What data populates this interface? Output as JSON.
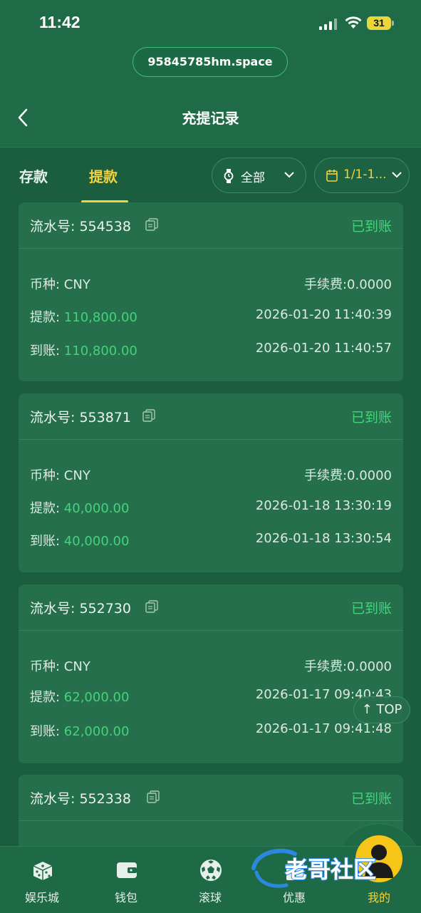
{
  "status_bar": {
    "time": "11:42",
    "battery": "31"
  },
  "url": "95845785hm.space",
  "header": {
    "title": "充提记录"
  },
  "tabs": [
    {
      "label": "存款"
    },
    {
      "label": "提款"
    }
  ],
  "filters": {
    "type": "全部",
    "date": "1/1-1..."
  },
  "records": [
    {
      "serial": "流水号: 554538",
      "status": "已到账",
      "currency": "币种: CNY",
      "fee": "手续费:0.0000",
      "withdraw_label": "提款: ",
      "withdraw_amount": "110,800.00",
      "withdraw_time": "2026-01-20 11:40:39",
      "arrive_label": "到账: ",
      "arrive_amount": "110,800.00",
      "arrive_time": "2026-01-20 11:40:57"
    },
    {
      "serial": "流水号: 553871",
      "status": "已到账",
      "currency": "币种: CNY",
      "fee": "手续费:0.0000",
      "withdraw_label": "提款: ",
      "withdraw_amount": "40,000.00",
      "withdraw_time": "2026-01-18 13:30:19",
      "arrive_label": "到账: ",
      "arrive_amount": "40,000.00",
      "arrive_time": "2026-01-18 13:30:54"
    },
    {
      "serial": "流水号: 552730",
      "status": "已到账",
      "currency": "币种: CNY",
      "fee": "手续费:0.0000",
      "withdraw_label": "提款: ",
      "withdraw_amount": "62,000.00",
      "withdraw_time": "2026-01-17 09:40:43",
      "arrive_label": "到账: ",
      "arrive_amount": "62,000.00",
      "arrive_time": "2026-01-17 09:41:48"
    },
    {
      "serial": "流水号: 552338",
      "status": "已到账"
    }
  ],
  "top_button": "↑ TOP",
  "bottom_nav": [
    {
      "label": "娱乐城",
      "icon": "dice-icon"
    },
    {
      "label": "钱包",
      "icon": "wallet-icon"
    },
    {
      "label": "滚球",
      "icon": "soccer-ball-icon"
    },
    {
      "label": "优惠",
      "icon": "gift-icon"
    },
    {
      "label": "我的",
      "icon": "avatar-icon"
    }
  ],
  "watermark": "老哥社区",
  "colors": {
    "background": "#1f6a47",
    "card": "#256f4d",
    "accent_yellow": "#f3d23d",
    "success_green": "#45d37a"
  }
}
